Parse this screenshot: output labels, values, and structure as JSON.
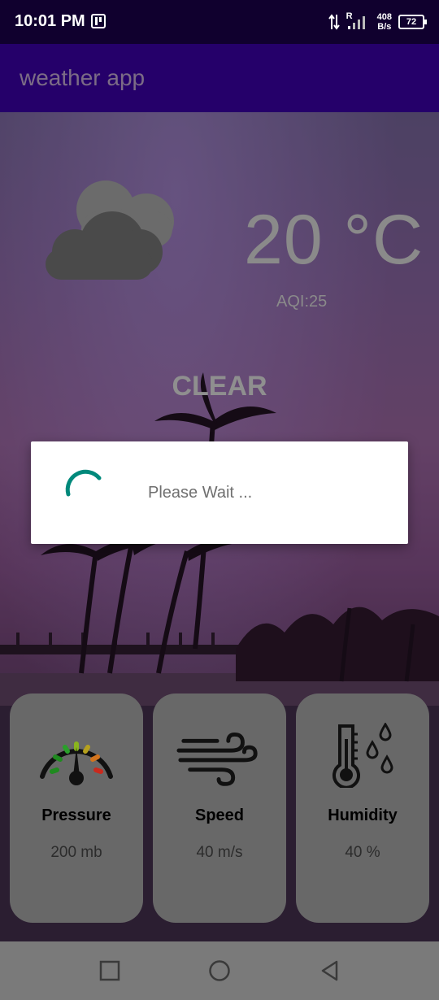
{
  "status_bar": {
    "time": "10:01 PM",
    "signal_label": "R",
    "net_speed_value": "408",
    "net_speed_unit": "B/s",
    "battery": "72"
  },
  "app_bar": {
    "title": "weather app"
  },
  "weather": {
    "icon": "cloud-icon",
    "temperature": "20 °C",
    "aqi": "AQI:25",
    "condition": "CLEAR"
  },
  "dialog": {
    "message": "Please Wait ..."
  },
  "cards": [
    {
      "icon": "gauge-icon",
      "label": "Pressure",
      "value": "200 mb"
    },
    {
      "icon": "wind-icon",
      "label": "Speed",
      "value": "40 m/s"
    },
    {
      "icon": "thermometer-drops-icon",
      "label": "Humidity",
      "value": "40 %"
    }
  ],
  "colors": {
    "status_bar": "#10002e",
    "app_bar": "#25006a",
    "spinner": "#00897b",
    "card_bg": "#686868"
  }
}
